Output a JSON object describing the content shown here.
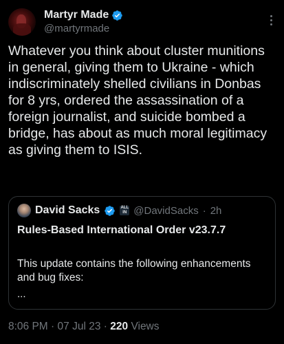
{
  "author": {
    "display_name": "Martyr Made",
    "handle": "@martyrmade"
  },
  "tweet": {
    "text": "Whatever you think about cluster munitions in general, giving them to Ukraine - which indiscriminately shelled civilians in Donbas for 8 yrs, ordered the assassination of a foreign journalist, and suicide bombed a bridge, has about as much moral legitimacy as giving them to ISIS."
  },
  "quoted": {
    "display_name": "David Sacks",
    "badge_line1": "ALL",
    "badge_line2": "IN",
    "handle": "@DavidSacks",
    "separator": "·",
    "time": "2h",
    "title": "Rules-Based International Order v23.7.7",
    "body": "This update contains the following enhancements and bug fixes:",
    "ellipsis": "..."
  },
  "meta": {
    "time": "8:06 PM",
    "sep1": "·",
    "date": "07 Jul 23",
    "sep2": "·",
    "views_count": "220",
    "views_label": "Views"
  },
  "colors": {
    "background": "#000000",
    "text": "#e7e9ea",
    "muted": "#71767b",
    "verified": "#1d9bf0",
    "border": "#2f3336"
  },
  "icons": {
    "verified": "verified-badge-icon",
    "more": "more-options-icon"
  }
}
